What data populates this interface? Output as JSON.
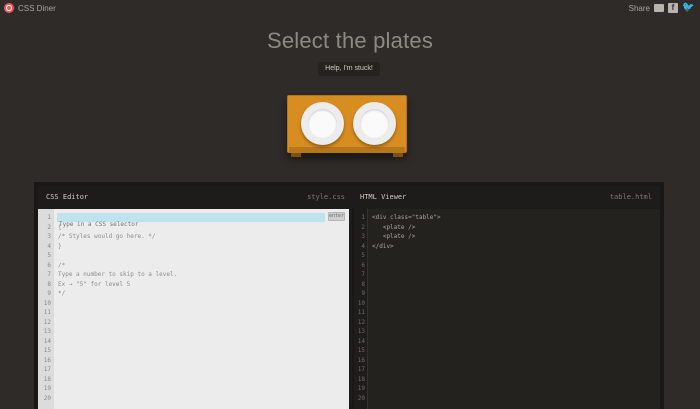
{
  "app": {
    "name": "CSS Diner"
  },
  "share": {
    "label": "Share",
    "icons": [
      "mail-icon",
      "facebook-icon",
      "twitter-icon"
    ]
  },
  "level": {
    "title": "Select the plates",
    "help_label": "Help, I'm stuck!"
  },
  "css_editor": {
    "title": "CSS Editor",
    "filename": "style.css",
    "input_placeholder": "Type in a CSS selector",
    "enter_label": "enter",
    "lines": [
      "{",
      "/* Styles would go here. */",
      "}",
      "",
      "/*",
      "Type a number to skip to a level.",
      "Ex → \"5\" for level 5",
      "*/"
    ],
    "line_numbers": [
      "1",
      "2",
      "3",
      "4",
      "5",
      "6",
      "7",
      "8",
      "9",
      "10",
      "11",
      "12",
      "13",
      "14",
      "15",
      "16",
      "17",
      "18",
      "19",
      "20"
    ]
  },
  "html_viewer": {
    "title": "HTML Viewer",
    "filename": "table.html",
    "lines": [
      "<div class=\"table\">",
      "   <plate />",
      "   <plate />",
      "</div>"
    ],
    "line_numbers": [
      "1",
      "2",
      "3",
      "4",
      "5",
      "6",
      "7",
      "8",
      "9",
      "10",
      "11",
      "12",
      "13",
      "14",
      "15",
      "16",
      "17",
      "18",
      "19",
      "20"
    ]
  },
  "colors": {
    "background": "#2f2b28",
    "table": "#d88d20",
    "input_highlight": "#bfe3ee",
    "logo": "#f25a5a"
  }
}
